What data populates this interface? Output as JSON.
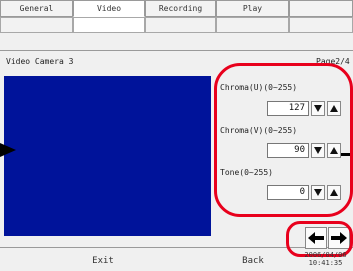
{
  "tabs": [
    "General",
    "Video",
    "Recording",
    "Play",
    ""
  ],
  "camera_title": "Video Camera 3",
  "page_indicator": "Page2/4",
  "controls": {
    "chroma_u": {
      "label": "Chroma(U)(0~255)",
      "value": "127"
    },
    "chroma_v": {
      "label": "Chroma(V)(0~255)",
      "value": "90"
    },
    "tone": {
      "label": "Tone(0~255)",
      "value": "0"
    }
  },
  "footer": {
    "exit_label": "Exit",
    "back_label": "Back",
    "date": "2006/04/06",
    "time": "10:41:35"
  },
  "colors": {
    "preview": "#00139a",
    "highlight": "#e8001c"
  },
  "icons": {
    "down": "triangle-down",
    "up": "triangle-up",
    "left": "arrow-left",
    "right": "arrow-right",
    "callout": "arrow-right-filled"
  }
}
